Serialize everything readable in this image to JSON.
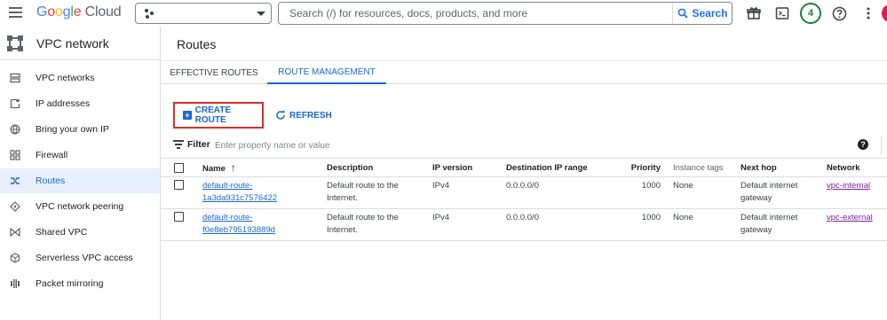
{
  "topbar": {
    "logo_google": "Google",
    "logo_cloud": "Cloud",
    "search_placeholder": "Search (/) for resources, docs, products, and more",
    "search_button": "Search",
    "notification_count": "4"
  },
  "sidebar": {
    "title": "VPC network",
    "items": [
      {
        "label": "VPC networks",
        "icon": "vpc-networks-icon"
      },
      {
        "label": "IP addresses",
        "icon": "ip-addresses-icon"
      },
      {
        "label": "Bring your own IP",
        "icon": "byoip-icon"
      },
      {
        "label": "Firewall",
        "icon": "firewall-icon"
      },
      {
        "label": "Routes",
        "icon": "routes-icon",
        "active": true
      },
      {
        "label": "VPC network peering",
        "icon": "peering-icon"
      },
      {
        "label": "Shared VPC",
        "icon": "shared-vpc-icon"
      },
      {
        "label": "Serverless VPC access",
        "icon": "serverless-icon"
      },
      {
        "label": "Packet mirroring",
        "icon": "packet-mirroring-icon"
      }
    ]
  },
  "main": {
    "title": "Routes",
    "tabs": [
      {
        "label": "EFFECTIVE ROUTES",
        "active": false
      },
      {
        "label": "ROUTE MANAGEMENT",
        "active": true
      }
    ],
    "create_route": "CREATE ROUTE",
    "refresh": "REFRESH",
    "filter_label": "Filter",
    "filter_placeholder": "Enter property name or value",
    "table": {
      "columns": [
        "Name",
        "Description",
        "IP version",
        "Destination IP range",
        "Priority",
        "Instance tags",
        "Next hop",
        "Network"
      ],
      "rows": [
        {
          "name_line1": "default-route-",
          "name_line2": "1a3da931c7576422",
          "desc_line1": "Default route to the",
          "desc_line2": "Internet.",
          "ip_version": "IPv4",
          "dest_range": "0.0.0.0/0",
          "priority": "1000",
          "instance_tags": "None",
          "next_hop_line1": "Default internet",
          "next_hop_line2": "gateway",
          "network": "vpc-internal"
        },
        {
          "name_line1": "default-route-",
          "name_line2": "f0e8eb795193889d",
          "desc_line1": "Default route to the",
          "desc_line2": "Internet.",
          "ip_version": "IPv4",
          "dest_range": "0.0.0.0/0",
          "priority": "1000",
          "instance_tags": "None",
          "next_hop_line1": "Default internet",
          "next_hop_line2": "gateway",
          "network": "vpc-external"
        }
      ]
    }
  },
  "colors": {
    "accent": "#1967d2",
    "highlight_border": "#d93025",
    "visited_link": "#7b1fa2",
    "active_nav_bg": "#e8f0fe"
  }
}
